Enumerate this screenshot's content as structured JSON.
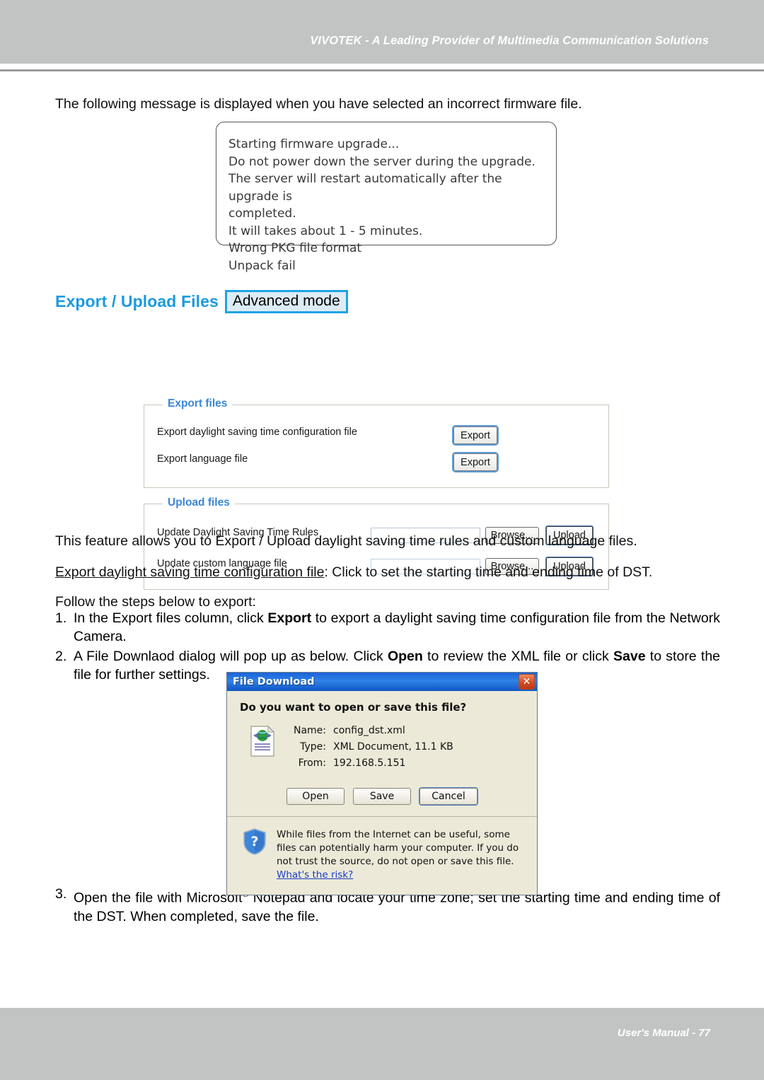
{
  "page": {
    "header_title": "VIVOTEK - A Leading Provider of Multimedia Communication Solutions",
    "footer_title": "User's Manual - 77",
    "header_band_color": "#c2c4c4",
    "footer_band_color": "#c2c4c4"
  },
  "intro": {
    "text": "The following message is displayed when you have selected an incorrect firmware file."
  },
  "message_box": {
    "lines": [
      "Starting firmware upgrade...",
      "Do not power down the server during the upgrade.",
      "The server will restart automatically after the upgrade is\ncompleted.",
      "It will takes about 1 - 5 minutes.",
      "Wrong PKG file format",
      "Unpack fail"
    ]
  },
  "section": {
    "title": "Export / Upload Files",
    "badge": "Advanced mode",
    "title_color": "#1c9ae0",
    "badge_border_color": "#1fa3e6"
  },
  "export_panel": {
    "legend": "Export files",
    "rows": [
      {
        "label": "Export daylight saving time configuration file",
        "button": "Export"
      },
      {
        "label": "Export language file",
        "button": "Export"
      }
    ]
  },
  "upload_panel": {
    "legend": "Upload files",
    "rows": [
      {
        "label": "Update Daylight Saving Time Rules",
        "value": "",
        "browse": "Browse...",
        "upload": "Upload"
      },
      {
        "label": "Update custom language file",
        "value": "",
        "browse": "Browse...",
        "upload": "Upload"
      }
    ]
  },
  "description": {
    "feature": "This feature allows you to Export / Upload daylight saving time rules and custom language files.",
    "export_link_label": "Export daylight saving time configuration file",
    "export_desc": ": Click to set the starting time and ending time of DST.",
    "follow": "Follow the steps below to export:"
  },
  "steps": {
    "one": {
      "num": "1.",
      "a": "In the Export files column, click ",
      "bold1": "Export",
      "b": " to export a daylight saving time configuration file from the Network Camera."
    },
    "two": {
      "num": "2.",
      "a": "A File Downlaod dialog will pop up as below. Click ",
      "bold1": "Open",
      "b": " to review the XML file or click ",
      "bold2": "Save",
      "c": " to store the file for further settings."
    },
    "three": {
      "num": "3.",
      "a": "Open the file with Microsoft",
      "sup": "®",
      "b": " Notepad and locate your time zone; set the starting time and ending time of the DST. When completed, save the file."
    }
  },
  "dialog": {
    "title": "File Download",
    "close_label": "✕",
    "question": "Do you want to open or save this file?",
    "fields": [
      {
        "key": "Name:",
        "value": "config_dst.xml"
      },
      {
        "key": "Type:",
        "value": "XML Document, 11.1 KB"
      },
      {
        "key": "From:",
        "value": "192.168.5.151"
      }
    ],
    "buttons": [
      {
        "label": "Open",
        "focused": false
      },
      {
        "label": "Save",
        "focused": false
      },
      {
        "label": "Cancel",
        "focused": true
      }
    ],
    "warning": {
      "text": "While files from the Internet can be useful, some files can potentially harm your computer. If you do not trust the source, do not open or save this file. ",
      "link": "What's the risk?"
    },
    "titlebar_color": "#1b63d8",
    "body_color": "#ece9d8"
  }
}
